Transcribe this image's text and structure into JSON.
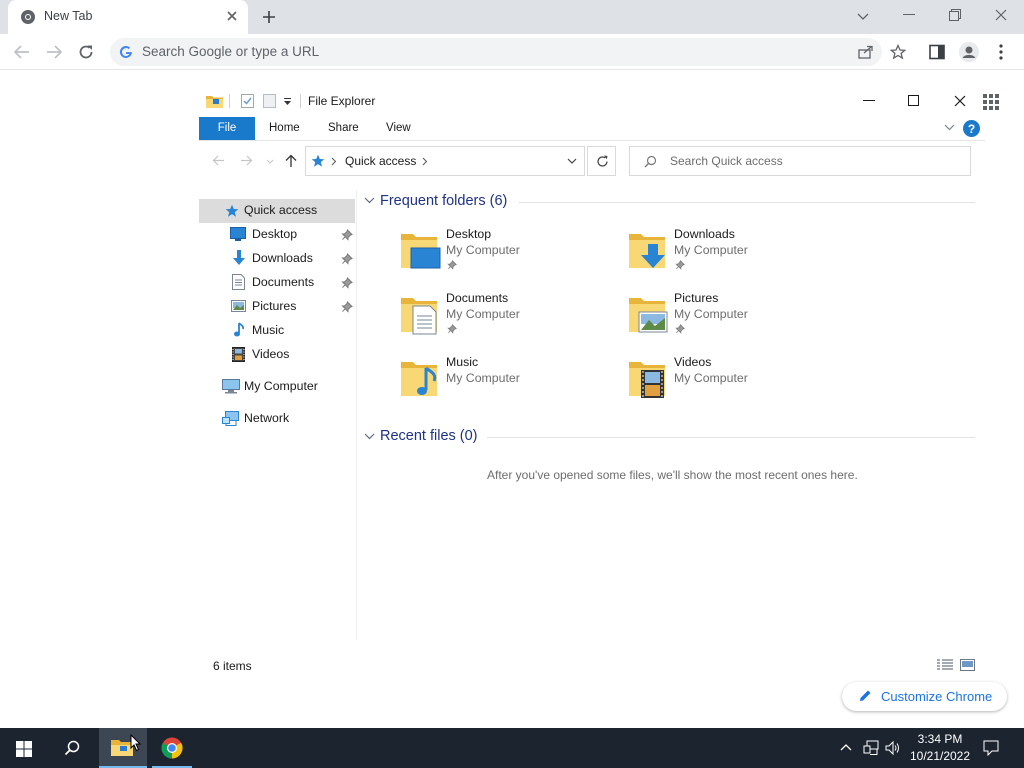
{
  "browser": {
    "tab_title": "New Tab",
    "omnibox_placeholder": "Search Google or type a URL",
    "customize_label": "Customize Chrome"
  },
  "explorer": {
    "title": "File Explorer",
    "ribbon": {
      "file": "File",
      "home": "Home",
      "share": "Share",
      "view": "View"
    },
    "address": {
      "location": "Quick access"
    },
    "search_placeholder": "Search Quick access",
    "nav": {
      "quick_access": "Quick access",
      "items": [
        "Desktop",
        "Downloads",
        "Documents",
        "Pictures",
        "Music",
        "Videos"
      ],
      "my_computer": "My Computer",
      "network": "Network"
    },
    "frequent": {
      "header": "Frequent folders (6)",
      "folders": [
        {
          "name": "Desktop",
          "location": "My Computer",
          "pinned": true
        },
        {
          "name": "Downloads",
          "location": "My Computer",
          "pinned": true
        },
        {
          "name": "Documents",
          "location": "My Computer",
          "pinned": true
        },
        {
          "name": "Pictures",
          "location": "My Computer",
          "pinned": true
        },
        {
          "name": "Music",
          "location": "My Computer",
          "pinned": false
        },
        {
          "name": "Videos",
          "location": "My Computer",
          "pinned": false
        }
      ]
    },
    "recent": {
      "header": "Recent files (0)",
      "empty_message": "After you've opened some files, we'll show the most recent ones here."
    },
    "status": "6 items"
  },
  "taskbar": {
    "time": "3:34 PM",
    "date": "10/21/2022"
  },
  "colors": {
    "accent": "#1979ca",
    "taskbar": "#1c2430",
    "group_header": "#1e3287",
    "folder_yellow": "#f8d775"
  }
}
